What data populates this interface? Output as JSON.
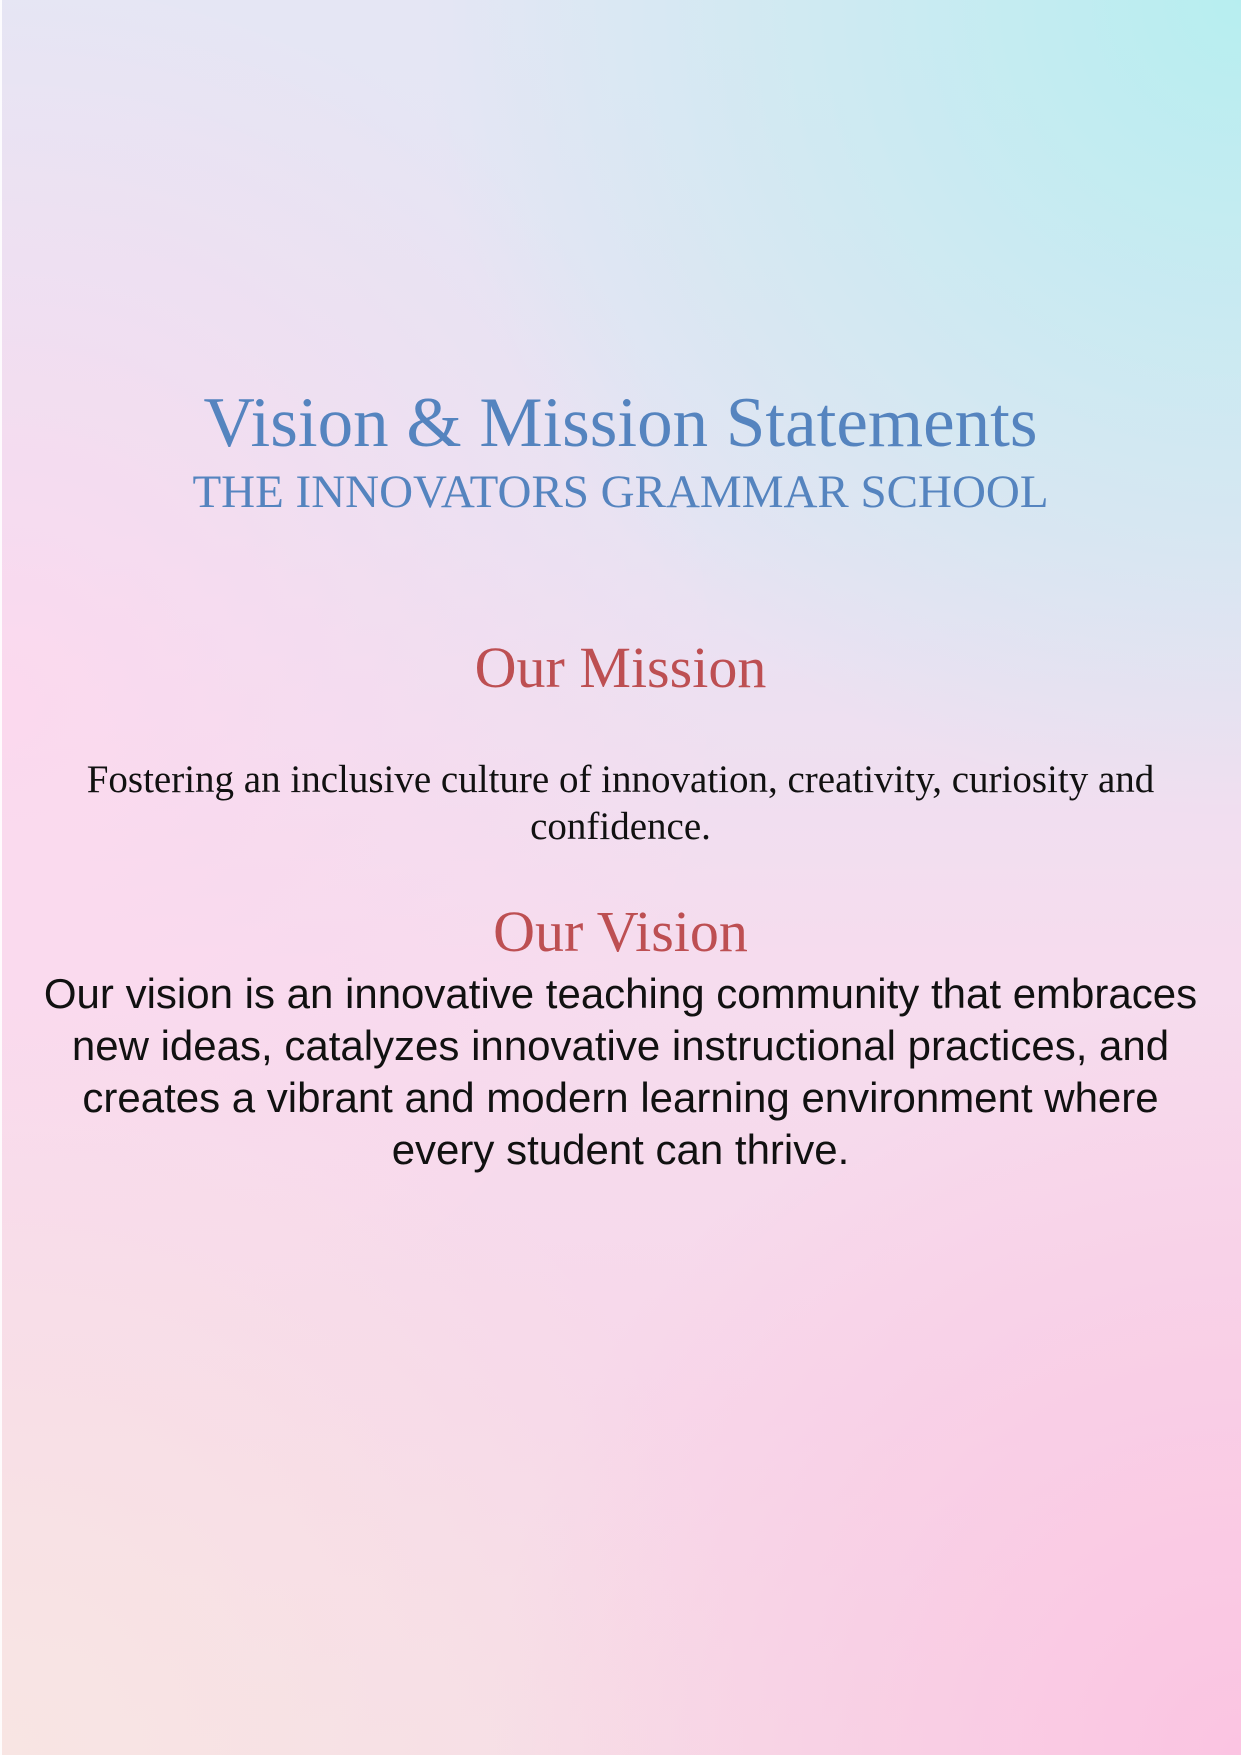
{
  "document": {
    "title": "Vision & Mission Statements",
    "school_name": "THE INNOVATORS GRAMMAR SCHOOL",
    "mission": {
      "heading": "Our Mission",
      "text": "Fostering an inclusive culture of innovation, creativity, curiosity and confidence."
    },
    "vision": {
      "heading": "Our Vision",
      "text": "Our vision is an innovative teaching community that embraces new ideas, catalyzes innovative instructional practices, and creates a vibrant and modern learning environment where every student can thrive."
    }
  },
  "colors": {
    "title": "#5584bf",
    "section_heading": "#bd4f52",
    "body_text": "#111111"
  }
}
